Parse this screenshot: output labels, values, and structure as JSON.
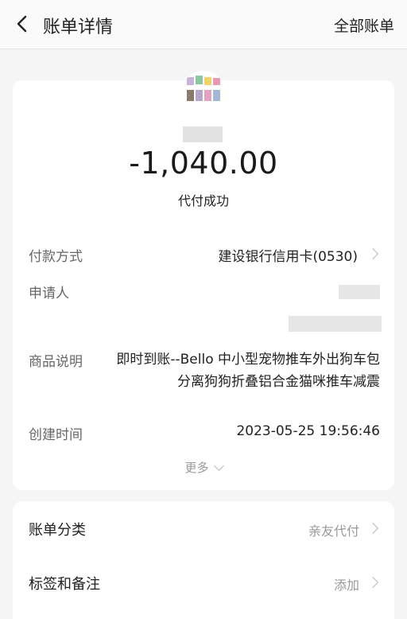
{
  "nav": {
    "title": "账单详情",
    "right": "全部账单"
  },
  "summary": {
    "amount": "-1,040.00",
    "status": "代付成功"
  },
  "details": {
    "payment_method_label": "付款方式",
    "payment_method_value": "建设银行信用卡(0530)",
    "applicant_label": "申请人",
    "product_label": "商品说明",
    "product_value_line1": "即时到账--Bello 中小型宠物推车外出狗车包",
    "product_value_line2": "分离狗狗折叠铝合金猫咪推车减震",
    "created_label": "创建时间",
    "created_value": "2023-05-25 19:56:46",
    "more": "更多"
  },
  "extra": {
    "category_label": "账单分类",
    "category_value": "亲友代付",
    "tags_label": "标签和备注",
    "tags_value": "添加"
  }
}
